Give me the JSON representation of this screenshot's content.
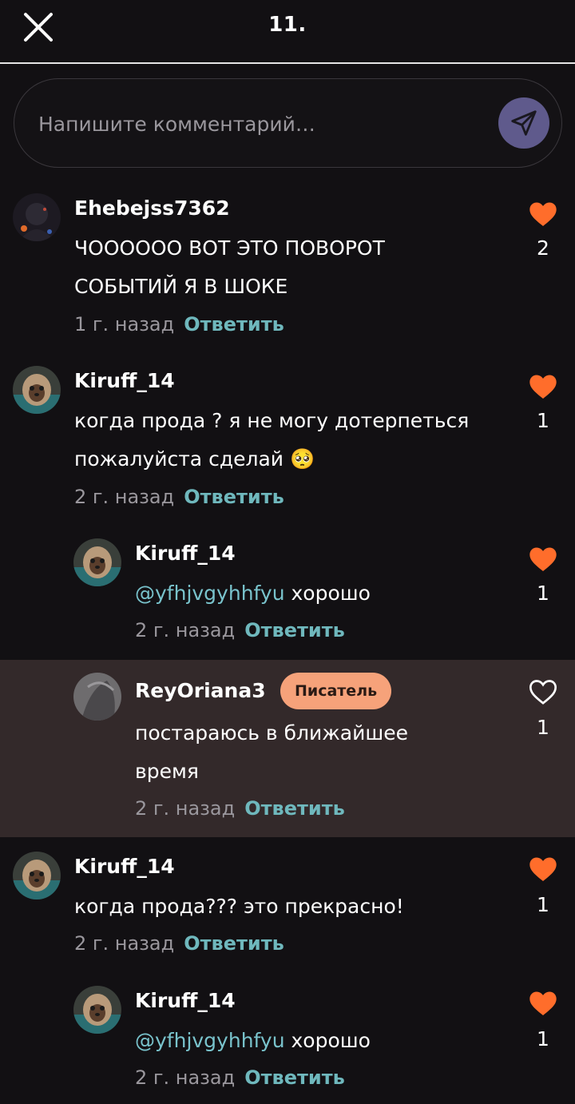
{
  "header": {
    "title": "11.",
    "close_icon": "close-icon"
  },
  "composer": {
    "placeholder": "Напишите комментарий…",
    "send_icon": "send-icon"
  },
  "reply_label": "Ответить",
  "colors": {
    "accent_heart": "#ff6d2b",
    "link": "#6fb8bd",
    "badge": "#f6a27a",
    "highlight": "#33292a"
  },
  "comments": [
    {
      "username": "Ehebejss7362",
      "text": "ЧОООООО ВОТ ЭТО ПОВОРОТ СОБЫТИЙ Я В ШОКЕ",
      "time": "1 г. назад",
      "likes": "2",
      "liked": true
    },
    {
      "username": "Kiruff_14",
      "text": "когда прода ? я не могу дотерпеться пожалуйста сделай 🥺",
      "time": "2 г. назад",
      "likes": "1",
      "liked": true
    },
    {
      "username": "Kiruff_14",
      "mention": "@yfhjvgyhhfyu",
      "text": " хорошо",
      "time": "2 г. назад",
      "likes": "1",
      "liked": true
    },
    {
      "username": "ReyOriana3",
      "badge": "Писатель",
      "text": "постараюсь в ближайшее время",
      "time": "2 г. назад",
      "likes": "1",
      "liked": false
    },
    {
      "username": "Kiruff_14",
      "text": "когда прода??? это прекрасно!",
      "time": "2 г. назад",
      "likes": "1",
      "liked": true
    },
    {
      "username": "Kiruff_14",
      "mention": "@yfhjvgyhhfyu",
      "text": " хорошо",
      "time": "2 г. назад",
      "likes": "1",
      "liked": true
    }
  ]
}
